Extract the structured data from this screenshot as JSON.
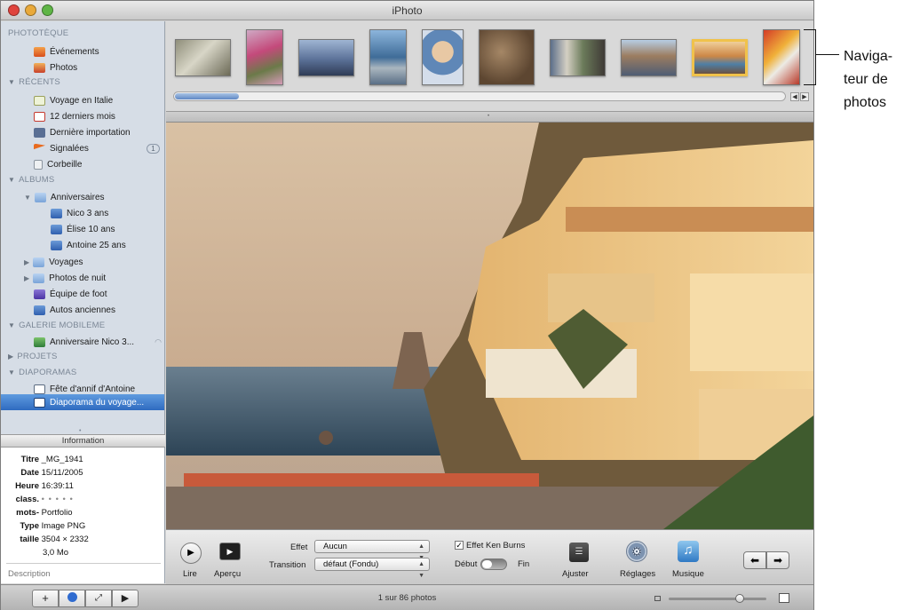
{
  "window": {
    "title": "iPhoto"
  },
  "sidebar": {
    "sections": {
      "library": "PHOTOTÈQUE",
      "recent": "RÉCENTS",
      "albums": "ALBUMS",
      "mobileme": "GALERIE MOBILEME",
      "projects": "PROJETS",
      "slideshows": "DIAPORAMAS"
    },
    "library_items": [
      "Événements",
      "Photos"
    ],
    "recent_items": [
      "Voyage en Italie",
      "12 derniers mois",
      "Dernière importation",
      "Signalées",
      "Corbeille"
    ],
    "flagged_count": "1",
    "albums": {
      "anniversaires": "Anniversaires",
      "nico": "Nico 3 ans",
      "elise": "Élise 10 ans",
      "antoine": "Antoine 25 ans",
      "voyages": "Voyages",
      "photos_nuit": "Photos de nuit",
      "equipe": "Équipe de foot",
      "autos": "Autos anciennes"
    },
    "mobileme_item": "Anniversaire Nico 3...",
    "slideshow_items": [
      "Fête d'annif d'Antoine",
      "Diaporama du voyage..."
    ]
  },
  "info": {
    "header": "Information",
    "labels": {
      "title": "Titre",
      "date": "Date",
      "time": "Heure",
      "rating": "class.",
      "keywords": "mots-",
      "type": "Type",
      "size": "taille"
    },
    "values": {
      "title": "_MG_1941",
      "date": "15/11/2005",
      "time": "16:39:11",
      "rating": "• • • • •",
      "keywords": "Portfolio",
      "type": "Image PNG",
      "size": "3504 × 2332",
      "filesize": "3,0 Mo"
    },
    "description": "Description"
  },
  "navigator": {
    "visible_thumbnails": 10,
    "selected_index": 8
  },
  "toolbar": {
    "play": "Lire",
    "preview": "Aperçu",
    "effect_label": "Effet",
    "effect_value": "Aucun",
    "transition_label": "Transition",
    "transition_value": "défaut (Fondu)",
    "kenburns_label": "Effet Ken Burns",
    "start_label": "Début",
    "end_label": "Fin",
    "adjust": "Ajuster",
    "settings": "Réglages",
    "music": "Musique"
  },
  "bottom": {
    "count_text": "1 sur 86 photos",
    "zoom_level": 0.75
  },
  "annotation": {
    "lines": [
      "Naviga-",
      "teur de",
      "photos"
    ]
  },
  "colors": {
    "selection": "#3c77c8",
    "sidebar": "#d6dde6"
  }
}
